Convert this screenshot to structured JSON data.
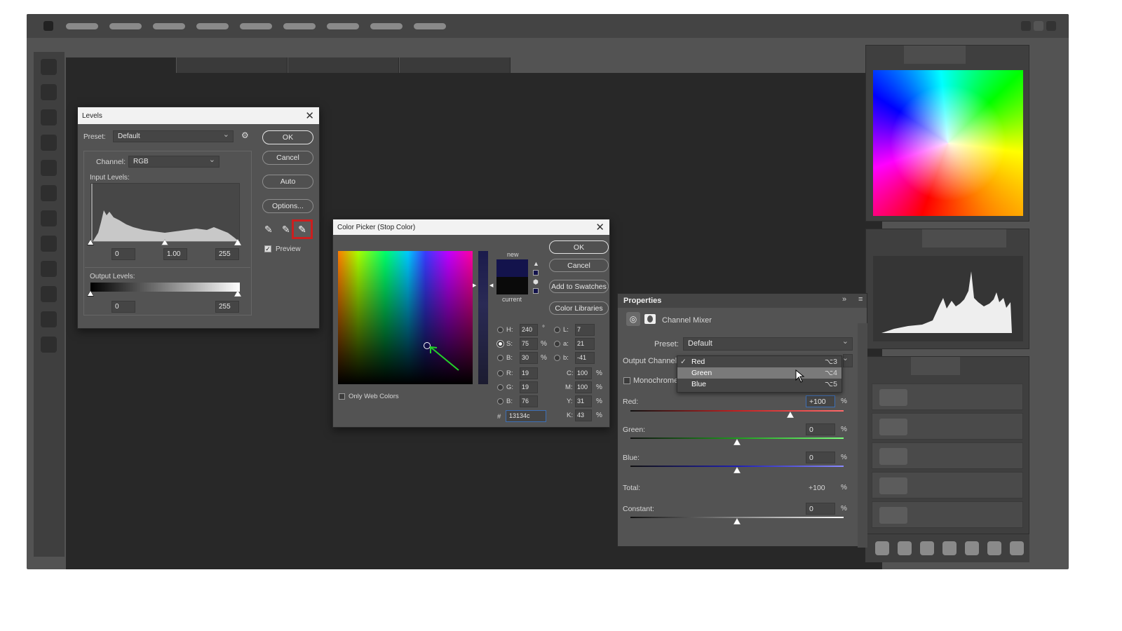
{
  "levels": {
    "title": "Levels",
    "preset_label": "Preset:",
    "preset_value": "Default",
    "channel_label": "Channel:",
    "channel_value": "RGB",
    "input_levels_label": "Input Levels:",
    "input_black": "0",
    "input_gamma": "1.00",
    "input_white": "255",
    "output_levels_label": "Output Levels:",
    "output_black": "0",
    "output_white": "255",
    "ok": "OK",
    "cancel": "Cancel",
    "auto": "Auto",
    "options": "Options...",
    "preview_label": "Preview",
    "preview_checked": true
  },
  "color_picker": {
    "title": "Color Picker (Stop Color)",
    "ok": "OK",
    "cancel": "Cancel",
    "add_to_swatches": "Add to Swatches",
    "color_libraries": "Color Libraries",
    "new_label": "new",
    "current_label": "current",
    "new_color": "#13134c",
    "current_color": "#0a0a0a",
    "only_web_colors": "Only Web Colors",
    "fields": {
      "H": "240",
      "S": "75",
      "B": "30",
      "R": "19",
      "G": "19",
      "Bv": "76",
      "L": "7",
      "a": "21",
      "b": "-41",
      "C": "100",
      "M": "100",
      "Y": "31",
      "K": "43"
    },
    "units": {
      "deg": "°",
      "pct": "%"
    },
    "hex_label": "#",
    "hex": "13134c"
  },
  "properties": {
    "title": "Properties",
    "adjustment_name": "Channel Mixer",
    "preset_label": "Preset:",
    "preset_value": "Default",
    "output_channel_label": "Output Channel",
    "monochrome_label": "Monochrome",
    "dropdown": [
      {
        "label": "Red",
        "shortcut": "⌥3",
        "checked": true
      },
      {
        "label": "Green",
        "shortcut": "⌥4",
        "highlighted": true
      },
      {
        "label": "Blue",
        "shortcut": "⌥5"
      }
    ],
    "red_label": "Red:",
    "red_value": "+100",
    "green_label": "Green:",
    "green_value": "0",
    "blue_label": "Blue:",
    "blue_value": "0",
    "total_label": "Total:",
    "total_value": "+100",
    "constant_label": "Constant:",
    "constant_value": "0",
    "pct": "%"
  },
  "colors": {
    "app_bg": "#535353",
    "canvas_bg": "#282828",
    "accent_highlight": "#cc1f1f",
    "green_arrow": "#23d12a"
  }
}
